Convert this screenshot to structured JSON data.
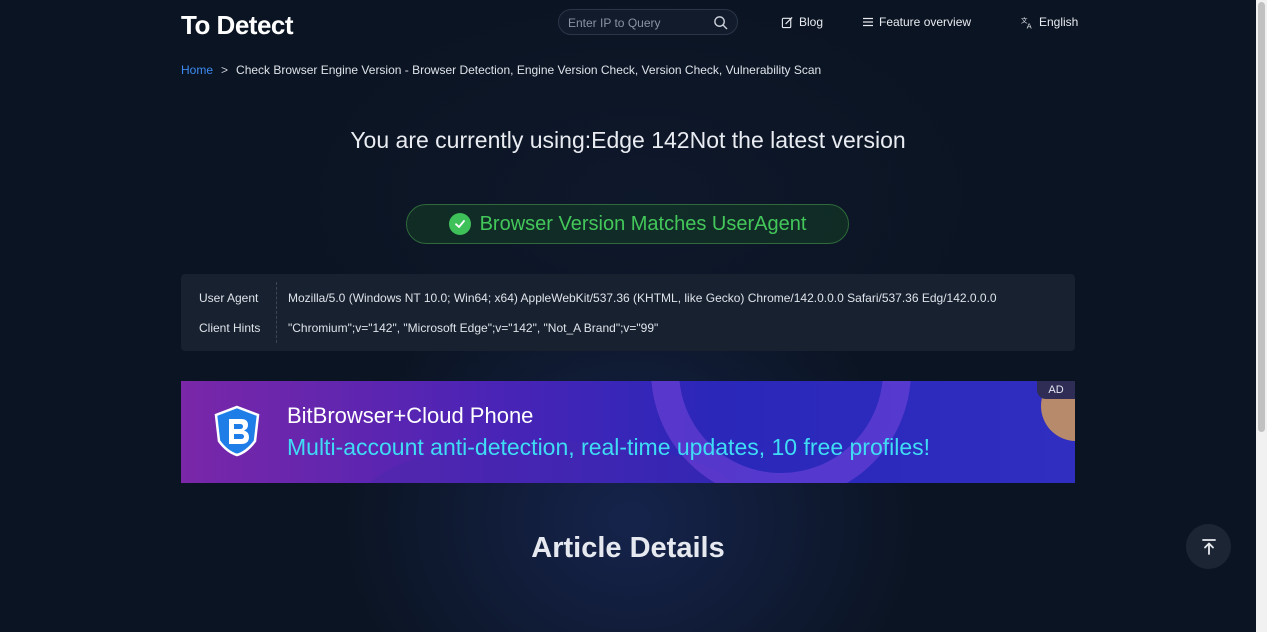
{
  "header": {
    "logo_text": "To Detect",
    "search": {
      "placeholder": "Enter IP to Query"
    },
    "nav": [
      {
        "label": "Blog",
        "icon": "edit-icon"
      },
      {
        "label": "Feature overview",
        "icon": "menu-icon"
      },
      {
        "label": "English",
        "icon": "translate-icon"
      }
    ]
  },
  "breadcrumb": {
    "home": "Home",
    "separator": ">",
    "current": "Check Browser Engine Version - Browser Detection, Engine Version Check, Version Check, Vulnerability Scan"
  },
  "headline": "You are currently using:Edge 142Not the latest version",
  "match_badge": {
    "text": "Browser Version Matches UserAgent",
    "color": "#43c75a"
  },
  "info": {
    "user_agent": {
      "label": "User Agent",
      "value": "Mozilla/5.0 (Windows NT 10.0; Win64; x64) AppleWebKit/537.36 (KHTML, like Gecko) Chrome/142.0.0.0 Safari/537.36 Edg/142.0.0.0"
    },
    "client_hints": {
      "label": "Client Hints",
      "value": "\"Chromium\";v=\"142\", \"Microsoft Edge\";v=\"142\", \"Not_A Brand\";v=\"99\""
    }
  },
  "ad": {
    "title": "BitBrowser+Cloud Phone",
    "subtitle": "Multi-account anti-detection, real-time updates, 10 free profiles!",
    "tag": "AD",
    "accent_color": "#3fdcf6"
  },
  "article_title": "Article Details",
  "colors": {
    "background": "#0b1422",
    "link": "#3d8bf2"
  }
}
